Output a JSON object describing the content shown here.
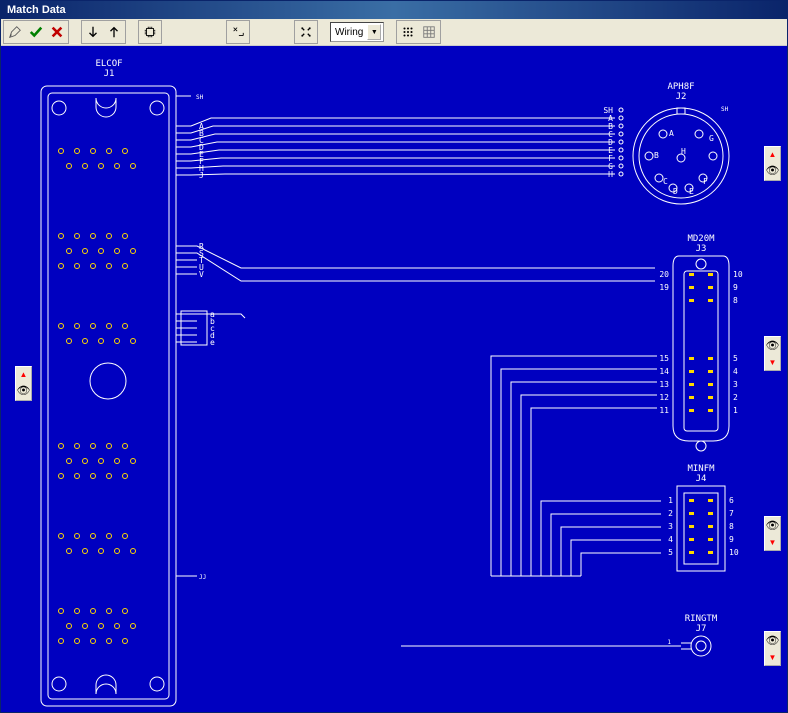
{
  "window": {
    "title": "Match Data"
  },
  "toolbar": {
    "pencil": "Edit",
    "check": "Accept",
    "cross": "Reject",
    "down": "Down",
    "up": "Up",
    "chip": "Component",
    "xref": "Cross Reference",
    "fourarrow": "Center",
    "combo_label": "Wiring",
    "dots": "Options",
    "grid": "Grid"
  },
  "connectors": {
    "j1": {
      "name": "ELCOF",
      "ref": "J1"
    },
    "j2": {
      "name": "APH8F",
      "ref": "J2"
    },
    "j3": {
      "name": "MD20M",
      "ref": "J3"
    },
    "j4": {
      "name": "MINFM",
      "ref": "J4"
    },
    "j7": {
      "name": "RINGTM",
      "ref": "J7"
    }
  },
  "signals": {
    "sh": "SH",
    "j1_top_out": [
      "A",
      "B",
      "C",
      "D",
      "E",
      "F",
      "H",
      "J"
    ],
    "j1_mid_out": [
      "R",
      "S",
      "T",
      "U",
      "V"
    ],
    "j1_box_out": [
      "a",
      "b",
      "c",
      "d",
      "e"
    ],
    "j1_jj": "JJ",
    "j2_left": [
      "SH",
      "A",
      "B",
      "C",
      "D",
      "E",
      "F",
      "G",
      "H"
    ],
    "j2_right_sh": "SH",
    "j2_inner": [
      "A",
      "B",
      "C",
      "D",
      "E",
      "F",
      "G",
      "H"
    ],
    "j3_left_top": [
      "20",
      "19"
    ],
    "j3_left_bot": [
      "15",
      "14",
      "13",
      "12",
      "11"
    ],
    "j3_right_top": [
      "10",
      "9",
      "8"
    ],
    "j3_right_bot": [
      "5",
      "4",
      "3",
      "2",
      "1"
    ],
    "j4_left": [
      "1",
      "2",
      "3",
      "4",
      "5"
    ],
    "j4_right": [
      "6",
      "7",
      "8",
      "9",
      "10"
    ],
    "j7_pin": "1"
  }
}
